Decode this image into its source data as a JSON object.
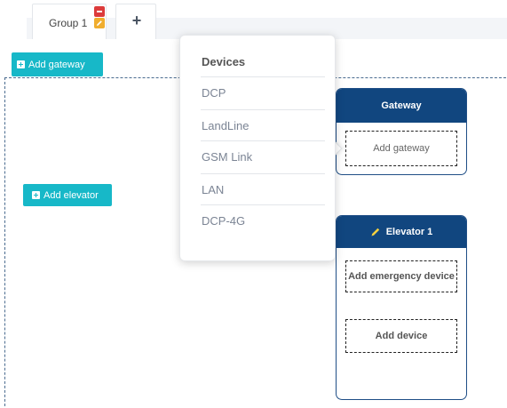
{
  "tabs": {
    "group_label": "Group 1",
    "add_tab_label": "+"
  },
  "toolbar": {
    "add_gateway_label": "Add gateway"
  },
  "canvas": {
    "add_elevator_label": "Add elevator"
  },
  "dropdown": {
    "title": "Devices",
    "items": [
      "DCP",
      "LandLine",
      "GSM Link",
      "LAN",
      "DCP-4G"
    ]
  },
  "gateway_card": {
    "title": "Gateway",
    "slot_label": "Add gateway"
  },
  "elevator_card": {
    "title": "Elevator 1",
    "emergency_label": "Add emergency device",
    "device_label": "Add device"
  },
  "colors": {
    "accent_teal": "#17b8c8",
    "header_navy": "#11467f",
    "delete_red": "#dc3b3b",
    "edit_orange": "#f0ad2e"
  },
  "icons": [
    "plus-square-icon",
    "pencil-icon",
    "minus-square-icon",
    "edit-square-icon"
  ]
}
